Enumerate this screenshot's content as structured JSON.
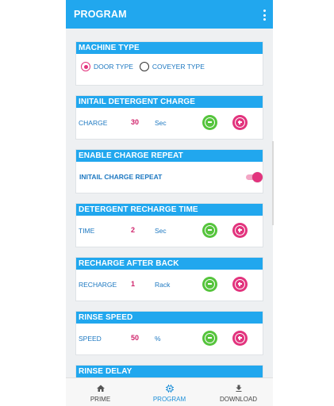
{
  "app": {
    "title": "PROGRAM"
  },
  "machine_type": {
    "header": "MACHINE TYPE",
    "options": [
      {
        "label": "DOOR TYPE",
        "selected": true
      },
      {
        "label": "COVEYER TYPE",
        "selected": false
      }
    ]
  },
  "detergent_charge": {
    "header": "INITAIL DETERGENT CHARGE",
    "label": "CHARGE",
    "value": "30",
    "unit": "Sec"
  },
  "charge_repeat": {
    "header": "ENABLE CHARGE REPEAT",
    "label": "INITAIL CHARGE REPEAT",
    "enabled": true
  },
  "recharge_time": {
    "header": "DETERGENT RECHARGE TIME",
    "label": "TIME",
    "value": "2",
    "unit": "Sec"
  },
  "recharge_after_back": {
    "header": "RECHARGE AFTER BACK",
    "label": "RECHARGE",
    "value": "1",
    "unit": "Rack"
  },
  "rinse_speed": {
    "header": "RINSE SPEED",
    "label": "SPEED",
    "value": "50",
    "unit": "%"
  },
  "rinse_delay": {
    "header": "RINSE DELAY"
  },
  "nav": {
    "items": [
      {
        "label": "PRIME",
        "icon": "home-icon",
        "active": false
      },
      {
        "label": "PROGRAM",
        "icon": "chip-icon",
        "active": true
      },
      {
        "label": "DOWNLOAD",
        "icon": "download-icon",
        "active": false
      }
    ]
  },
  "colors": {
    "accent": "#21a7ee",
    "value": "#d0246c",
    "minus": "#55c43c",
    "plus": "#e2337d"
  }
}
